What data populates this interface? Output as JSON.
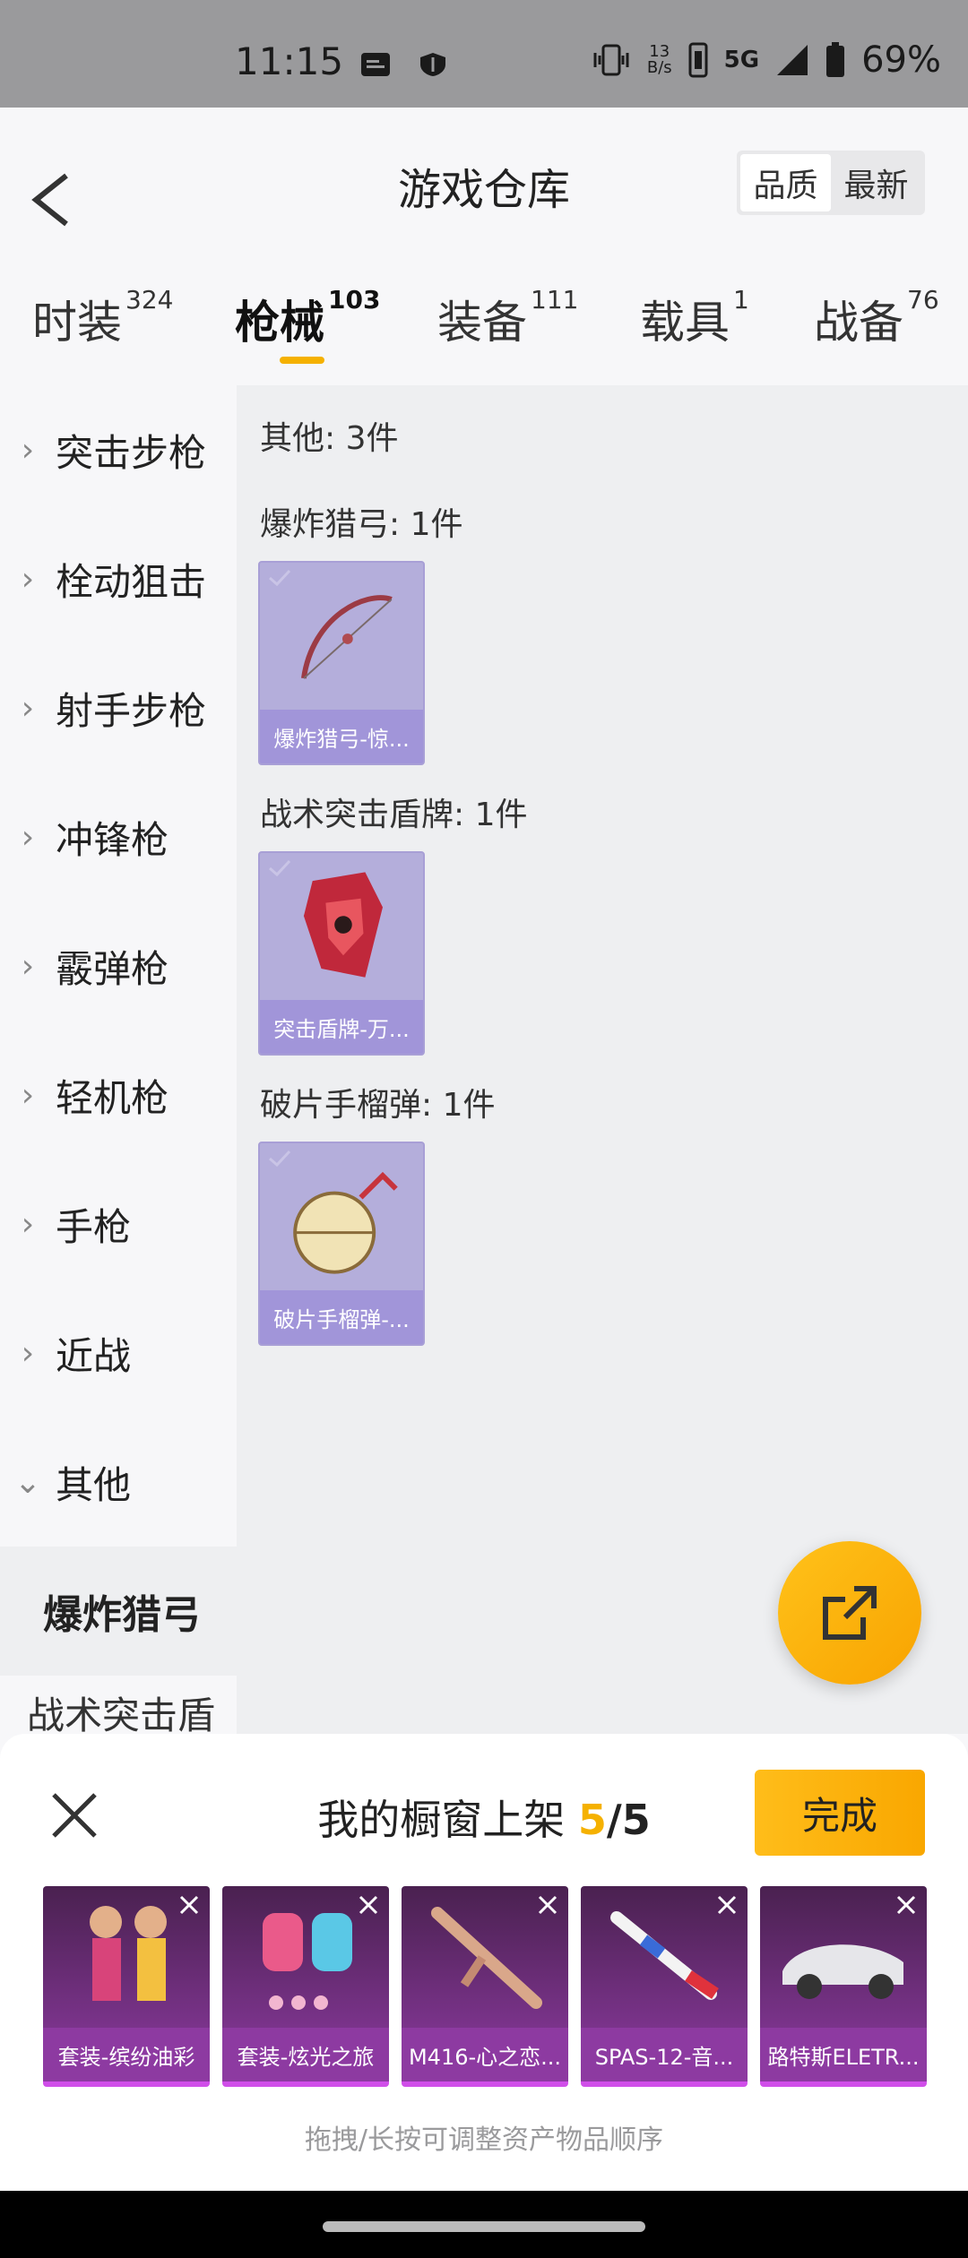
{
  "status_bar": {
    "time": "11:15",
    "net_speed_top": "13",
    "net_speed_bottom": "B/s",
    "network": "5G",
    "battery": "69%"
  },
  "header": {
    "title": "游戏仓库",
    "sort_quality": "品质",
    "sort_latest": "最新"
  },
  "tabs": [
    {
      "label": "时装",
      "count": "324"
    },
    {
      "label": "枪械",
      "count": "103"
    },
    {
      "label": "装备",
      "count": "111"
    },
    {
      "label": "载具",
      "count": "1"
    },
    {
      "label": "战备",
      "count": "76"
    }
  ],
  "sidebar": {
    "categories": [
      "突击步枪",
      "栓动狙击",
      "射手步枪",
      "冲锋枪",
      "霰弹枪",
      "轻机枪",
      "手枪",
      "近战",
      "其他"
    ],
    "sub_active": "爆炸猎弓",
    "sub_partial": "战术突击盾牌"
  },
  "content": {
    "summary": "其他: 3件",
    "groups": [
      {
        "title": "爆炸猎弓: 1件",
        "item_label": "爆炸猎弓-惊..."
      },
      {
        "title": "战术突击盾牌: 1件",
        "item_label": "突击盾牌-万..."
      },
      {
        "title": "破片手榴弹: 1件",
        "item_label": "破片手榴弹-..."
      }
    ]
  },
  "showcase": {
    "title_prefix": "我的橱窗上架",
    "current": "5",
    "total": "/5",
    "done_label": "完成",
    "items": [
      "套装-缤纷油彩",
      "套装-炫光之旅",
      "M416-心之恋...",
      "SPAS-12-音...",
      "路特斯ELETR..."
    ],
    "hint": "拖拽/长按可调整资产物品顺序"
  },
  "colors": {
    "accent": "#f5b100",
    "card_purple": "#b4aedb",
    "slot_purple": "#8d3aa1"
  }
}
